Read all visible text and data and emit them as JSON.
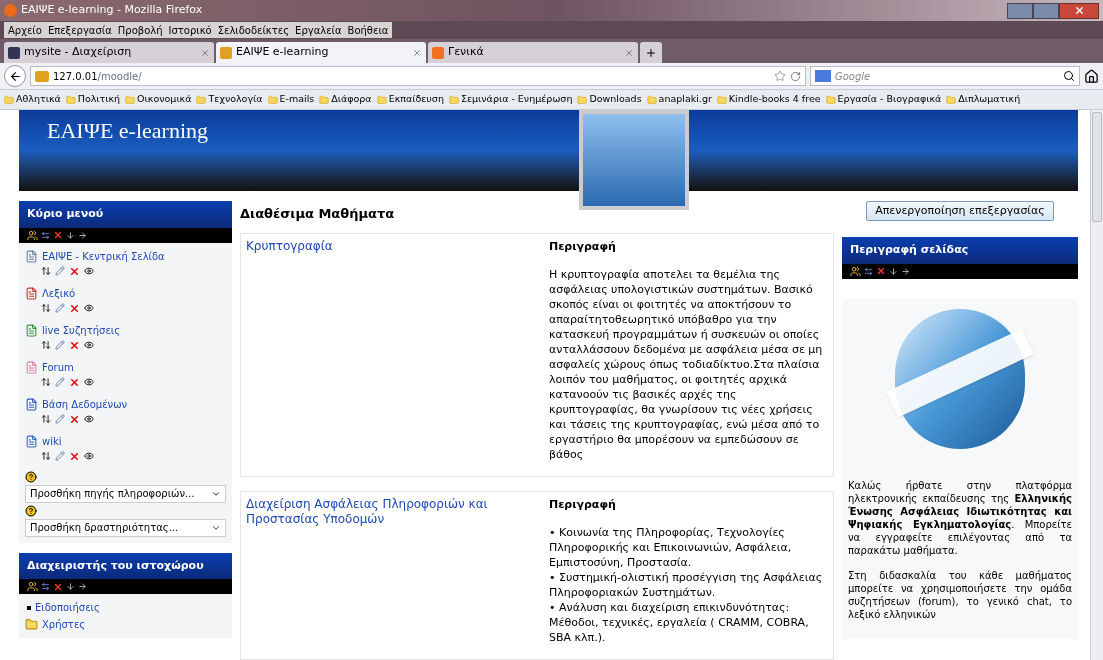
{
  "window": {
    "title": "ΕΑΙΨΕ e-learning - Mozilla Firefox"
  },
  "menu_bar": [
    "Αρχείο",
    "Επεξεργασία",
    "Προβολή",
    "Ιστορικό",
    "Σελιδοδείκτες",
    "Εργαλεία",
    "Βοήθεια"
  ],
  "tabs": [
    {
      "label": "mysite - Διαχείριση",
      "selected": false
    },
    {
      "label": "ΕΑΙΨΕ e-learning",
      "selected": true
    },
    {
      "label": "Γενικά",
      "selected": false
    }
  ],
  "address_bar": {
    "host": "127.0.01",
    "path": "/moodle/"
  },
  "search": {
    "placeholder": "Google"
  },
  "bookmarks": [
    "Αθλητικά",
    "Πολιτική",
    "Οικονομικά",
    "Τεχνολογία",
    "E-mails",
    "Διάφορα",
    "Εκπαίδευση",
    "Σεμινάρια - Ενημέρωση",
    "Downloads",
    "anaplaki.gr",
    "Kindle-books 4 free",
    "Εργασία - Βιογραφικά",
    "Διπλωματική"
  ],
  "site_title": "ΕΑΙΨΕ e-learning",
  "main_menu": {
    "title": "Κύριο μενού",
    "items": [
      {
        "label": "ΕΑΙΨΕ - Κεντρική Σελίδα"
      },
      {
        "label": "Λεξικό"
      },
      {
        "label": "live Συζητήσεις"
      },
      {
        "label": "Forum"
      },
      {
        "label": "Βάση Δεδομένων"
      },
      {
        "label": "wiki"
      }
    ],
    "selects": [
      {
        "value": "Προσθήκη πηγής πληροφοριών..."
      },
      {
        "value": "Προσθήκη δραστηριότητας..."
      }
    ]
  },
  "admin_block": {
    "title": "Διαχειριστής του ιστοχώρου",
    "items": [
      {
        "kind": "bullet",
        "label": "Ειδοποιήσεις"
      },
      {
        "kind": "folder",
        "label": "Χρήστες"
      }
    ]
  },
  "courses": {
    "title": "Διαθέσιμα Μαθήματα",
    "items": [
      {
        "name": "Κρυπτογραφία",
        "summary_title": "Περιγραφή",
        "summary": [
          "Η κρυπτογραφία αποτελει τα θεμέλια της ασφάλειας υπολογιστικών συστημάτων. Βασικό σκοπός είναι οι φοιτητές να αποκτήσουν το απαραίτητοθεωρητικό υπόβαθρο για την κατασκευή προγραμμάτων ή συσκευών οι οποίες ανταλλάσσουν δεδομένα με ασφάλεια μέσα σε μη ασφαλείς χώρους όπως τοδιαδίκτυο.Στα πλαίσια λοιπόν του μαθήματος, οι φοιτητές αρχικά κατανοούν τις βασικές αρχές της κρυπτογραφίας, θα γνωρίσουν τις νέες χρήσεις και τάσεις της κρυπτογραφίας, ενώ μέσα από το εργαστήριο θα μπορέσουν να εμπεδώσουν σε βάθος"
        ]
      },
      {
        "name": "Διαχείριση Ασφάλειας Πληροφοριών και Προστασίας Υποδομών",
        "summary_title": "Περιγραφή",
        "summary": [
          "• Κοινωνία της Πληροφορίας, Τεχνολογίες Πληροφορικής και Επικοινωνιών, Ασφάλεια, Εμπιστοσύνη, Προστασία.",
          "• Συστημική-ολιστική προσέγγιση της Ασφάλειας Πληροφοριακών Συστημάτων.",
          "• Ανάλυση και διαχείριση επικινδυνότητας: Μέθοδοι, τεχνικές, εργαλεία ( CRAMM, COBRA, SBA κλπ.)."
        ]
      }
    ]
  },
  "edit_button": "Απενεργοποίηση επεξεργασίας",
  "page_description": {
    "title": "Περιγραφή σελίδας",
    "paragraphs": [
      "Καλώς ήρθατε στην πλατφόρμα ηλεκτρονικής εκπαίδευσης της **Ελληνικής Ένωσης Ασφάλειας Ιδιωτικότητας και Ψηφιακής Εγκληματολογίας**. Μπορείτε να εγγραφείτε επιλέγοντας από τα παρακάτω μαθήματα.",
      "Στη διδασκαλία του κάθε μαθήματος μπορείτε να χρησιμοποιήσετε την ομάδα συζητήσεων (forum), το γενικό chat, το λεξικό ελληνικών"
    ]
  }
}
